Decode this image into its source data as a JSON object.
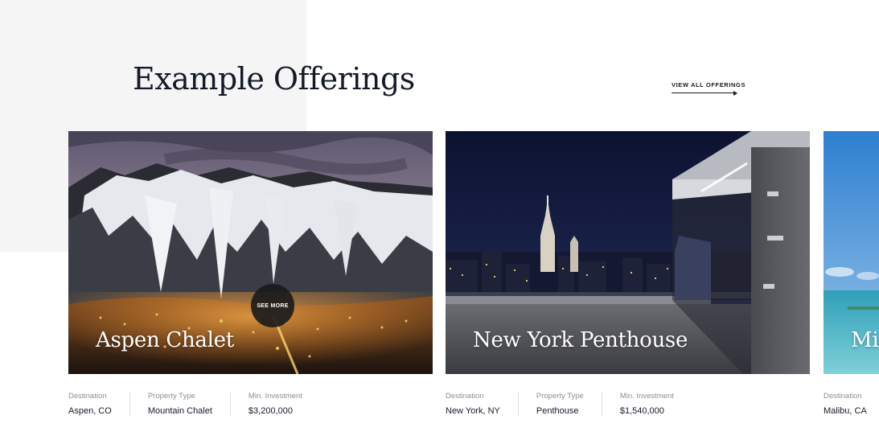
{
  "section": {
    "title": "Example Offerings",
    "view_all_label": "VIEW ALL OFFERINGS"
  },
  "labels": {
    "destination": "Destination",
    "property_type": "Property Type",
    "min_investment": "Min. Investment"
  },
  "see_more_label": "SEE MORE",
  "offerings": [
    {
      "name": "Aspen Chalet",
      "destination": "Aspen, CO",
      "property_type": "Mountain Chalet",
      "min_investment": "$3,200,000"
    },
    {
      "name": "New York Penthouse",
      "destination": "New York, NY",
      "property_type": "Penthouse",
      "min_investment": "$1,540,000"
    },
    {
      "name": "Mia",
      "destination": "Malibu, CA"
    }
  ],
  "colors": {
    "title": "#141a28",
    "label": "#8a8e98",
    "divider": "#dcdcdc",
    "see_more_bg": "#1a1a1c",
    "bg_block": "#f5f5f5"
  }
}
